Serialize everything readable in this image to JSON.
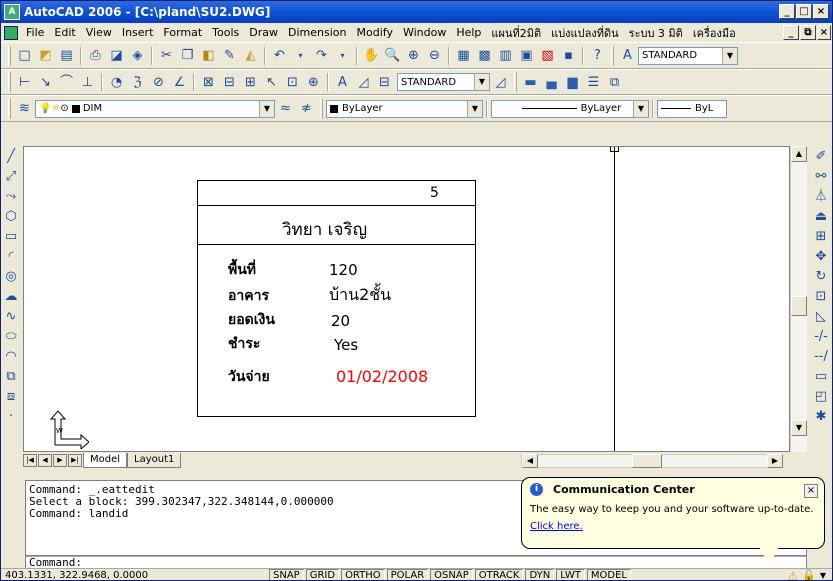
{
  "window": {
    "title": "AutoCAD 2006 - [C:\\pland\\SU2.DWG]",
    "min_label": "_",
    "max_label": "□",
    "close_label": "×",
    "doc_min_label": "_",
    "doc_max_label": "⧉",
    "doc_close_label": "×"
  },
  "menu": {
    "items": [
      "File",
      "Edit",
      "View",
      "Insert",
      "Format",
      "Tools",
      "Draw",
      "Dimension",
      "Modify",
      "Window",
      "Help",
      "แผนที่2มิติ",
      "แบ่งแปลงที่ดิน",
      "ระบบ 3 มิติ",
      "เครื่องมือ"
    ]
  },
  "toolbars": {
    "text_style": "STANDARD",
    "dim_style": "STANDARD",
    "layer": "DIM",
    "color": "ByLayer",
    "linetype": "ByLayer",
    "lineweight": "ByL"
  },
  "block": {
    "number": "5",
    "name": "วิทยา เจริญ",
    "fields": [
      {
        "label": "พื้นที่",
        "value": "120"
      },
      {
        "label": "อาคาร",
        "value": "บ้าน2ชั้น"
      },
      {
        "label": "ยอดเงิน",
        "value": "20"
      },
      {
        "label": "ชำระ",
        "value": "Yes"
      }
    ],
    "pay_date_label": "วันจ่าย",
    "pay_date": "01/02/2008",
    "pay_date_color": "#ff0000"
  },
  "layout_tabs": [
    "Model",
    "Layout1"
  ],
  "command": {
    "history": [
      "Command: _.eattedit",
      "Select a block: 399.302347,322.348144,0.000000",
      "Command: landid"
    ],
    "prompt": "Command:"
  },
  "status": {
    "coords": "403.1331, 322.9468, 0.0000",
    "toggles": [
      "SNAP",
      "GRID",
      "ORTHO",
      "POLAR",
      "OSNAP",
      "OTRACK",
      "DYN",
      "LWT",
      "MODEL"
    ]
  },
  "balloon": {
    "title": "Communication Center",
    "message": "The easy way to keep you and your software up-to-date.",
    "link": "Click here.",
    "close_label": "×",
    "info_label": "i"
  }
}
